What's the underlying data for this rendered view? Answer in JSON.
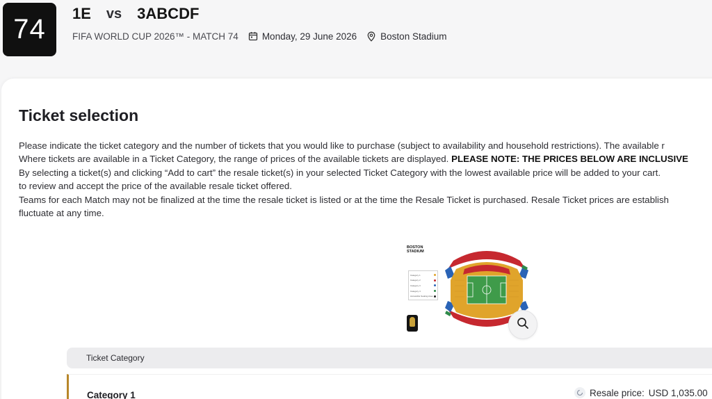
{
  "match": {
    "number": "74",
    "home_team": "1E",
    "vs": "vs",
    "away_team": "3ABCDF",
    "competition": "FIFA WORLD CUP 2026™ - MATCH 74",
    "date": "Monday, 29 June 2026",
    "venue": "Boston Stadium",
    "icons": {
      "date": "calendar-icon",
      "venue": "location-pin-icon"
    }
  },
  "ticket_selection": {
    "title": "Ticket selection",
    "lines": {
      "l1": "Please indicate the ticket category and the number of tickets that you would like to purchase (subject to availability and household restrictions). The available r",
      "l2a": "Where tickets are available in a Ticket Category, the range of prices of the available tickets are displayed. ",
      "l2b": "PLEASE NOTE: THE PRICES BELOW ARE INCLUSIVE",
      "l3": "By selecting a ticket(s) and clicking “Add to cart” the resale ticket(s) in your selected Ticket Category with the lowest available price will be added to your cart.",
      "l4": "to review and accept the price of the available resale ticket offered.",
      "l5": "Teams for each Match may not be finalized at the time the resale ticket is listed or at the time the Resale Ticket is purchased. Resale Ticket prices are establish",
      "l6": "fluctuate at any time."
    }
  },
  "stadium_map": {
    "title_line1": "BOSTON",
    "title_line2": "STADIUM",
    "legend": [
      {
        "label": "Category 1",
        "color": "#e0a42b"
      },
      {
        "label": "Category 2",
        "color": "#c6282f"
      },
      {
        "label": "Category 3",
        "color": "#2a63b6"
      },
      {
        "label": "Category 4",
        "color": "#2f8a4a"
      },
      {
        "label": "Accessible Seating Area",
        "color": "#222222"
      }
    ],
    "zoom_icon": "magnifier-icon"
  },
  "ticket_table": {
    "header": "Ticket Category",
    "rows": [
      {
        "category": "Category 1",
        "price_label": "Resale price:",
        "price": "USD 1,035.00",
        "accent": "#b8872a"
      }
    ]
  }
}
